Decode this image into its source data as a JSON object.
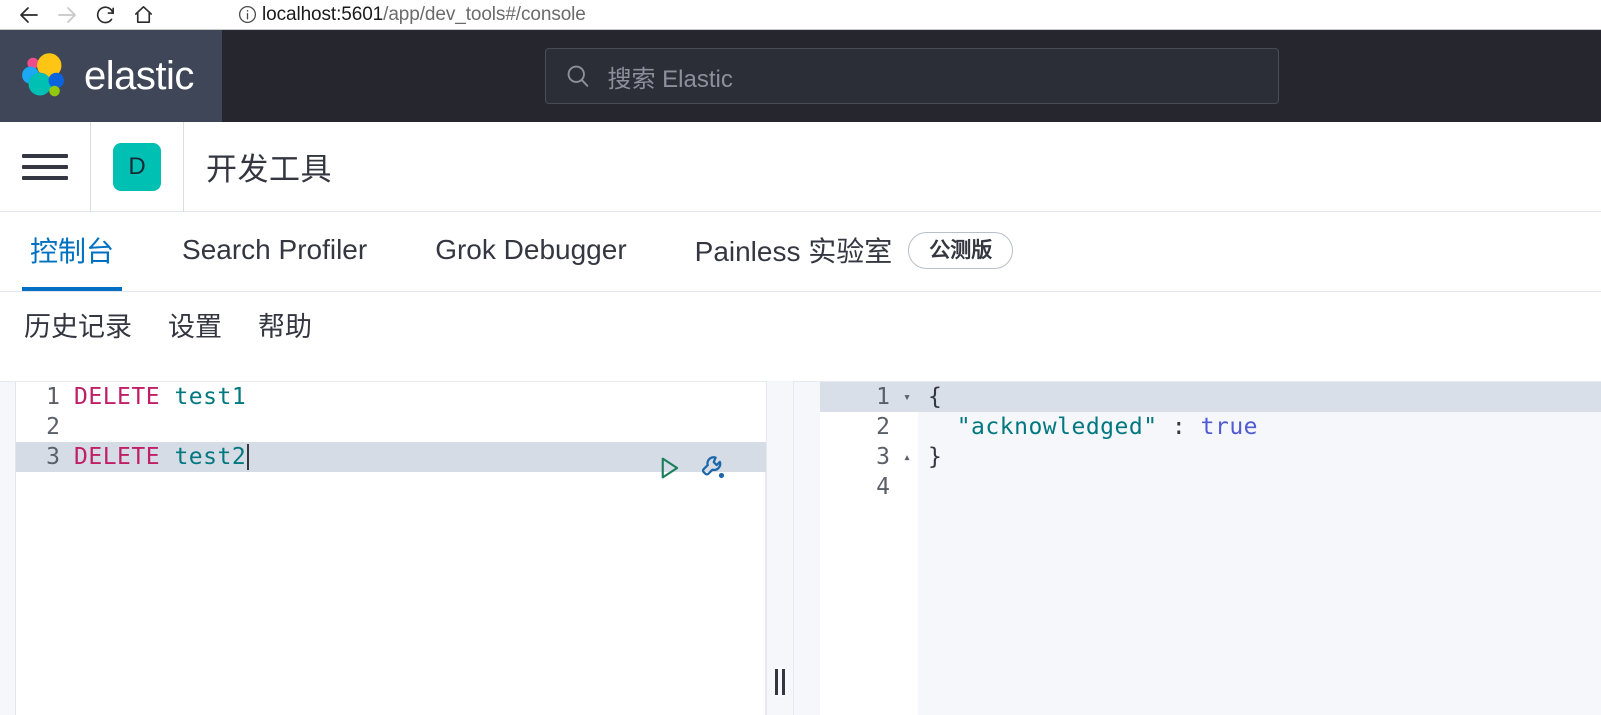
{
  "browser": {
    "back_label": "back",
    "forward_label": "forward",
    "reload_label": "reload",
    "home_label": "home",
    "url_host": "localhost:5601",
    "url_path": "/app/dev_tools#/console"
  },
  "header": {
    "brand": "elastic",
    "search_placeholder": "搜索 Elastic"
  },
  "app_nav": {
    "menu_label": "menu",
    "app_badge": "D",
    "app_title": "开发工具"
  },
  "tabs": [
    {
      "label": "控制台",
      "active": true,
      "badge": ""
    },
    {
      "label": "Search Profiler",
      "active": false,
      "badge": ""
    },
    {
      "label": "Grok Debugger",
      "active": false,
      "badge": ""
    },
    {
      "label": "Painless 实验室",
      "active": false,
      "badge": "公测版"
    }
  ],
  "sub_menu": [
    {
      "label": "历史记录"
    },
    {
      "label": "设置"
    },
    {
      "label": "帮助"
    }
  ],
  "editor": {
    "lines": [
      {
        "number": "1",
        "keyword": "DELETE",
        "target": "test1",
        "active": false
      },
      {
        "number": "2",
        "keyword": "",
        "target": "",
        "active": false
      },
      {
        "number": "3",
        "keyword": "DELETE",
        "target": "test2",
        "active": true
      }
    ],
    "play_label": "发送请求",
    "wrench_label": "打开菜单"
  },
  "response": {
    "lines": [
      {
        "number": "1",
        "fold": "▾",
        "text": "{",
        "active": true
      },
      {
        "number": "2",
        "fold": "",
        "text": "  \"acknowledged\" : true",
        "active": false
      },
      {
        "number": "3",
        "fold": "▴",
        "text": "}",
        "active": false
      },
      {
        "number": "4",
        "fold": "",
        "text": "",
        "active": false
      }
    ],
    "key": "\"acknowledged\"",
    "colon": " : ",
    "value": "true",
    "indent": "  "
  },
  "splitter": {
    "label": "拖动调整面板宽度"
  },
  "colors": {
    "header_bg": "#25262e",
    "logo_bg": "#3f4657",
    "accent_blue": "#0071c2",
    "badge_teal": "#00bfb3",
    "keyword": "#c01f67",
    "index": "#00787f",
    "json_key": "#00787f",
    "json_bool": "#4f5bd5",
    "active_line": "#d6dce6",
    "pane_bg": "#f5f7fa"
  }
}
